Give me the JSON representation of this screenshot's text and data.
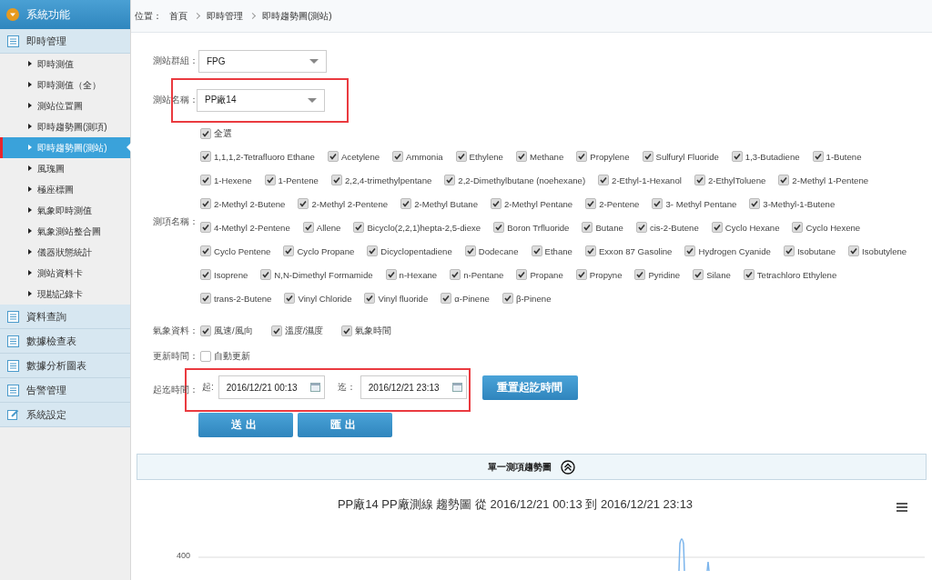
{
  "sidebar": {
    "title": "系統功能",
    "sections": [
      {
        "label": "即時管理",
        "kind": "list",
        "children": [
          {
            "label": "即時測值",
            "selected": false
          },
          {
            "label": "即時測值（全）",
            "selected": false
          },
          {
            "label": "測站位置圖",
            "selected": false
          },
          {
            "label": "即時趨勢圖(測項)",
            "selected": false
          },
          {
            "label": "即時趨勢圖(測站)",
            "selected": true
          },
          {
            "label": "風瑰圖",
            "selected": false
          },
          {
            "label": "極座標圖",
            "selected": false
          },
          {
            "label": "氣象即時測值",
            "selected": false
          },
          {
            "label": "氣象測站整合圖",
            "selected": false
          },
          {
            "label": "儀器狀態統計",
            "selected": false
          },
          {
            "label": "測站資料卡",
            "selected": false
          },
          {
            "label": "現勘記錄卡",
            "selected": false
          }
        ]
      },
      {
        "label": "資料查詢",
        "kind": "list"
      },
      {
        "label": "數據檢查表",
        "kind": "list"
      },
      {
        "label": "數據分析圖表",
        "kind": "list"
      },
      {
        "label": "告警管理",
        "kind": "list"
      },
      {
        "label": "系統設定",
        "kind": "edit"
      }
    ]
  },
  "breadcrumb": {
    "label": "位置：",
    "items": [
      "首頁",
      "即時管理",
      "即時趨勢圖(測站)"
    ]
  },
  "form": {
    "station_group": {
      "label": "測站群組：",
      "value": "FPG"
    },
    "station_name": {
      "label": "測站名稱：",
      "value": "PP廠14",
      "highlighted": true
    },
    "items": {
      "label": "測項名稱：",
      "select_all": {
        "label": "全選",
        "checked": true
      },
      "rows": [
        [
          {
            "label": "1,1,1,2-Tetrafluoro Ethane",
            "checked": true
          },
          {
            "label": "Acetylene",
            "checked": true
          },
          {
            "label": "Ammonia",
            "checked": true
          },
          {
            "label": "Ethylene",
            "checked": true
          },
          {
            "label": "Methane",
            "checked": true
          },
          {
            "label": "Propylene",
            "checked": true
          },
          {
            "label": "Sulfuryl Fluoride",
            "checked": true
          },
          {
            "label": "1,3-Butadiene",
            "checked": true
          },
          {
            "label": "1-Butene",
            "checked": true
          }
        ],
        [
          {
            "label": "1-Hexene",
            "checked": true
          },
          {
            "label": "1-Pentene",
            "checked": true
          },
          {
            "label": "2,2,4-trimethylpentane",
            "checked": true
          },
          {
            "label": "2,2-Dimethylbutane (noehexane)",
            "checked": true
          },
          {
            "label": "2-Ethyl-1-Hexanol",
            "checked": true
          },
          {
            "label": "2-EthylToluene",
            "checked": true
          },
          {
            "label": "2-Methyl 1-Pentene",
            "checked": true
          }
        ],
        [
          {
            "label": "2-Methyl 2-Butene",
            "checked": true
          },
          {
            "label": "2-Methyl 2-Pentene",
            "checked": true
          },
          {
            "label": "2-Methyl Butane",
            "checked": true
          },
          {
            "label": "2-Methyl Pentane",
            "checked": true
          },
          {
            "label": "2-Pentene",
            "checked": true
          },
          {
            "label": "3- Methyl Pentane",
            "checked": true
          },
          {
            "label": "3-Methyl-1-Butene",
            "checked": true
          }
        ],
        [
          {
            "label": "4-Methyl 2-Pentene",
            "checked": true
          },
          {
            "label": "Allene",
            "checked": true
          },
          {
            "label": "Bicyclo(2,2,1)hepta-2,5-diexe",
            "checked": true
          },
          {
            "label": "Boron Trfluoride",
            "checked": true
          },
          {
            "label": "Butane",
            "checked": true
          },
          {
            "label": "cis-2-Butene",
            "checked": true
          },
          {
            "label": "Cyclo Hexane",
            "checked": true
          },
          {
            "label": "Cyclo Hexene",
            "checked": true
          }
        ],
        [
          {
            "label": "Cyclo Pentene",
            "checked": true
          },
          {
            "label": "Cyclo Propane",
            "checked": true
          },
          {
            "label": "Dicyclopentadiene",
            "checked": true
          },
          {
            "label": "Dodecane",
            "checked": true
          },
          {
            "label": "Ethane",
            "checked": true
          },
          {
            "label": "Exxon 87 Gasoline",
            "checked": true
          },
          {
            "label": "Hydrogen Cyanide",
            "checked": true
          },
          {
            "label": "Isobutane",
            "checked": true
          },
          {
            "label": "Isobutylene",
            "checked": true
          }
        ],
        [
          {
            "label": "Isoprene",
            "checked": true
          },
          {
            "label": "N,N-Dimethyl Formamide",
            "checked": true
          },
          {
            "label": "n-Hexane",
            "checked": true
          },
          {
            "label": "n-Pentane",
            "checked": true
          },
          {
            "label": "Propane",
            "checked": true
          },
          {
            "label": "Propyne",
            "checked": true
          },
          {
            "label": "Pyridine",
            "checked": true
          },
          {
            "label": "Silane",
            "checked": true
          },
          {
            "label": "Tetrachloro Ethylene",
            "checked": true
          }
        ],
        [
          {
            "label": "trans-2-Butene",
            "checked": true
          },
          {
            "label": "Vinyl Chloride",
            "checked": true
          },
          {
            "label": "Vinyl fluoride",
            "checked": true
          },
          {
            "label": "α-Pinene",
            "checked": true
          },
          {
            "label": "β-Pinene",
            "checked": true
          }
        ]
      ]
    },
    "weather": {
      "label": "氣象資料：",
      "options": [
        {
          "label": "風速/風向",
          "checked": true
        },
        {
          "label": "溫度/濕度",
          "checked": true
        },
        {
          "label": "氣象時間",
          "checked": true
        }
      ]
    },
    "update": {
      "label": "更新時間：",
      "options": [
        {
          "label": "自動更新",
          "checked": false
        }
      ]
    },
    "time_range": {
      "label": "起迄時間：",
      "highlighted": true,
      "start_label": "起:",
      "start": "2016/12/21 00:13",
      "end_label": "迄：",
      "end": "2016/12/21 23:13",
      "reset_button": "重置起訖時間"
    },
    "buttons": [
      "送出",
      "匯出"
    ]
  },
  "panel": {
    "title": "單一測項趨勢圖",
    "expanded": true
  },
  "chart": {
    "title": "PP廠14 PP廠測線 趨勢圖 從 2016/12/21 00:13 到 2016/12/21 23:13",
    "y_tick": "400"
  }
}
